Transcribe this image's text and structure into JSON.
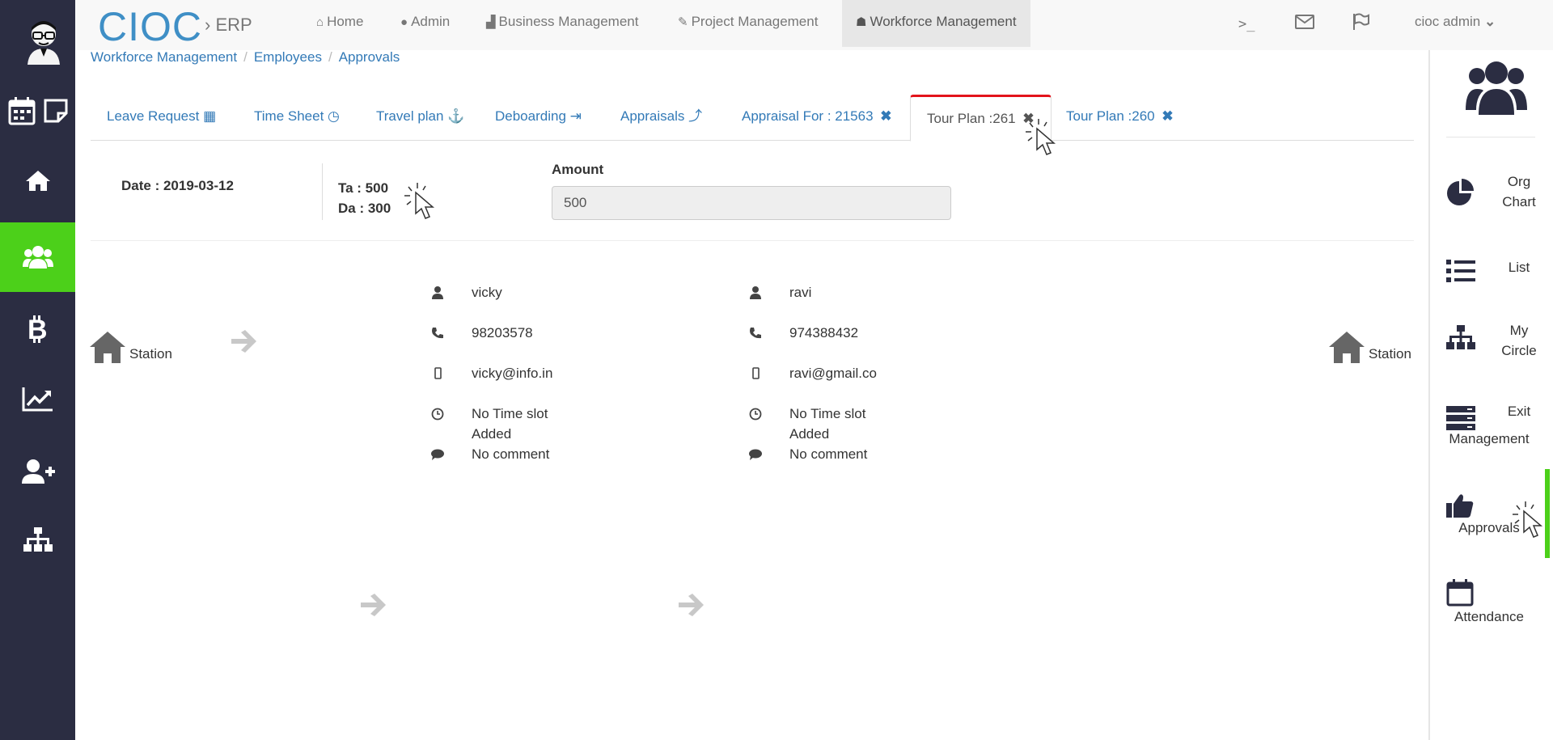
{
  "brand": {
    "name": "CIOC",
    "sub": "› ERP"
  },
  "topnav": {
    "items": [
      {
        "label": "Home",
        "icon": "home-icon"
      },
      {
        "label": "Admin",
        "icon": "user-icon"
      },
      {
        "label": "Business Management",
        "icon": "industry-icon"
      },
      {
        "label": "Project Management",
        "icon": "wrench-icon"
      },
      {
        "label": "Workforce Management",
        "icon": "users-icon",
        "active": true
      }
    ],
    "terminal_icon": ">_",
    "user": "cioc admin"
  },
  "breadcrumb": [
    "Workforce Management",
    "Employees",
    "Approvals"
  ],
  "tabs": [
    {
      "label": "Leave Request",
      "icon": "calendar-icon"
    },
    {
      "label": "Time Sheet",
      "icon": "clock-icon"
    },
    {
      "label": "Travel plan",
      "icon": "anchor-icon"
    },
    {
      "label": "Deboarding",
      "icon": "sign-out-icon"
    },
    {
      "label": "Appraisals",
      "icon": "line-chart-icon"
    },
    {
      "label": "Appraisal For : 21563",
      "icon": "close-icon"
    },
    {
      "label": "Tour Plan :261",
      "icon": "close-icon",
      "active": true
    },
    {
      "label": "Tour Plan :260",
      "icon": "close-icon"
    }
  ],
  "info": {
    "date": "Date : 2019-03-12",
    "ta": "Ta : 500",
    "da": "Da : 300",
    "amount_label": "Amount",
    "amount_value": "500"
  },
  "tour": {
    "start_station": "Station",
    "end_station": "Station",
    "people": [
      {
        "name": "vicky",
        "phone": "98203578",
        "email": "vicky@info.in",
        "time_line1": "No Time slot",
        "time_line2": "Added",
        "comment": "No comment"
      },
      {
        "name": "ravi",
        "phone": "974388432",
        "email": "ravi@gmail.co",
        "time_line1": "No Time slot",
        "time_line2": "Added",
        "comment": "No comment"
      }
    ]
  },
  "right_sidebar": {
    "items": [
      {
        "label_line1": "Org",
        "label_line2": "Chart",
        "icon": "pie-chart-icon"
      },
      {
        "label_line1": "List",
        "label_line2": "",
        "icon": "list-icon"
      },
      {
        "label_line1": "My",
        "label_line2": "Circle",
        "icon": "sitemap-icon"
      },
      {
        "label_line1": "Exit",
        "label_line2": "Management",
        "icon": "server-icon"
      },
      {
        "label_line1": "Approvals",
        "label_line2": "",
        "icon": "thumbs-up-icon"
      },
      {
        "label_line1": "Attendance",
        "label_line2": "",
        "icon": "calendar-icon"
      }
    ]
  },
  "colors": {
    "sidebar": "#2b2d42",
    "active_green": "#4cd01a",
    "link": "#337ab7",
    "brand": "#3f8fc6",
    "active_tab_top": "#e3141b"
  }
}
